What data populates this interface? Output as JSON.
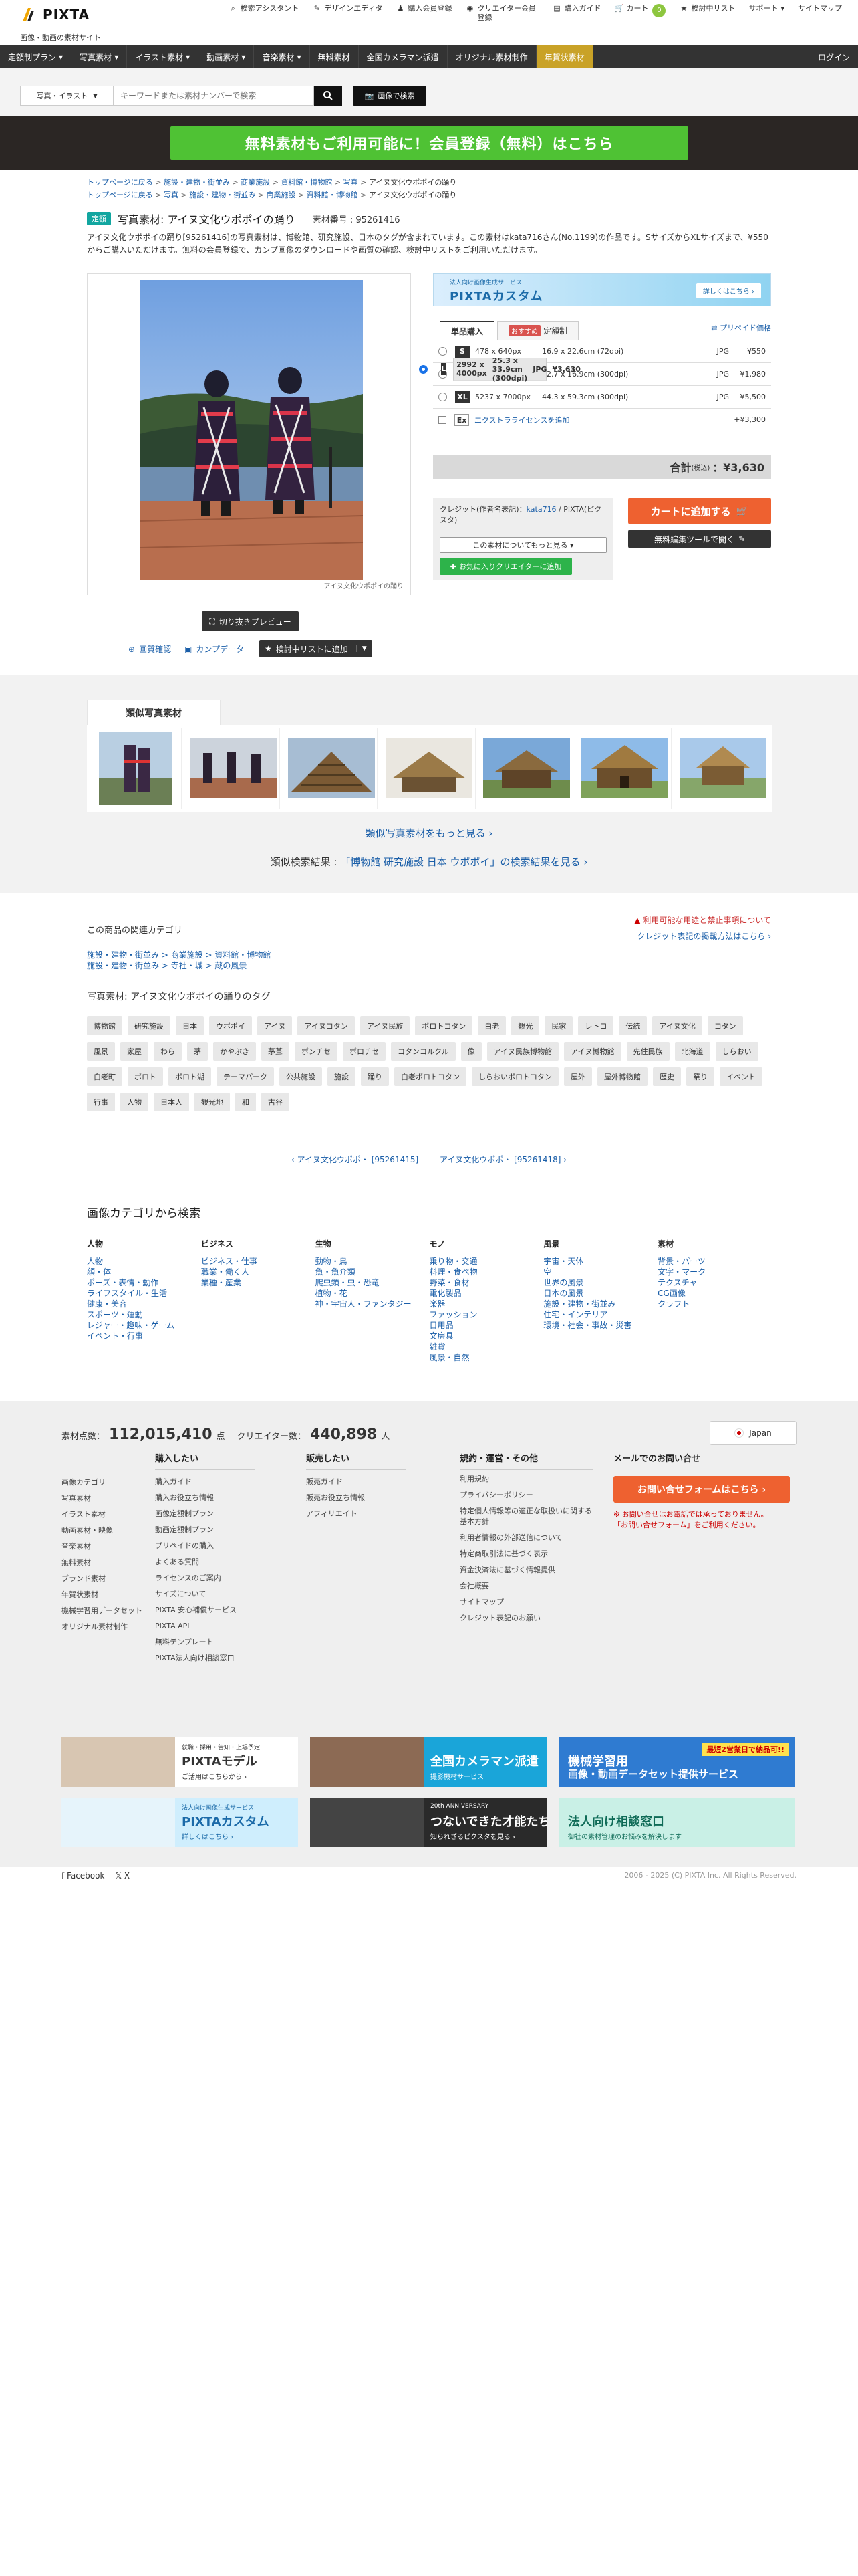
{
  "header": {
    "logo": "PIXTA",
    "subtitle": "画像・動画の素材サイト",
    "nav": [
      {
        "icon": "search-icon",
        "glyph": "⌕",
        "label": "検索アシスタント"
      },
      {
        "icon": "design-icon",
        "glyph": "✎",
        "label": "デザインエディタ"
      },
      {
        "icon": "register-icon",
        "glyph": "♟",
        "label": "購入会員登録"
      },
      {
        "icon": "camera-icon",
        "glyph": "◉",
        "label": "クリエイター会員登録"
      },
      {
        "icon": "guide-icon",
        "glyph": "▤",
        "label": "購入ガイド"
      },
      {
        "icon": "cart-icon",
        "glyph": "🛒",
        "label": "カート",
        "badge": "0"
      },
      {
        "icon": "star-icon",
        "glyph": "★",
        "label": "検討中リスト"
      },
      {
        "icon": "chevron-down-icon",
        "glyph": "",
        "label": "サポート"
      },
      {
        "icon": "sitemap-icon",
        "glyph": "",
        "label": "サイトマップ"
      }
    ]
  },
  "categories": [
    "定額制プラン",
    "写真素材",
    "イラスト素材",
    "動画素材",
    "音楽素材",
    "無料素材",
    "全国カメラマン派遣",
    "オリジナル素材制作",
    "年賀状素材"
  ],
  "login": "ログイン",
  "search": {
    "select_label": "写真・イラスト",
    "placeholder": "キーワードまたは素材ナンバーで検索",
    "image_search": "画像で検索"
  },
  "banner": {
    "text": "無料素材もご利用可能に！会員登録（無料）はこちら"
  },
  "breadcrumbs": [
    [
      "トップページに戻る",
      "施設・建物・街並み",
      "商業施設",
      "資料館・博物館",
      "写真",
      "アイヌ文化ウポポイの踊り"
    ],
    [
      "トップページに戻る",
      "写真",
      "施設・建物・街並み",
      "商業施設",
      "資料館・博物館",
      "アイヌ文化ウポポイの踊り"
    ]
  ],
  "product": {
    "badge": "定額",
    "title": "写真素材: アイヌ文化ウポポイの踊り",
    "number": "素材番号 : 95261416",
    "description": "アイヌ文化ウポポイの踊り[95261416]の写真素材は、博物館、研究施設、日本のタグが含まれています。この素材はkata716さん(No.1199)の作品です。SサイズからXLサイズまで、¥550からご購入いただけます。無料の会員登録で、カンプ画像のダウンロードや画質の確認、検討中リストをご利用いただけます。",
    "caption": "アイヌ文化ウポポイの踊り",
    "trim_preview": "切り抜きプレビュー",
    "actions": {
      "quality": "画質確認",
      "comp": "カンプデータ",
      "add_list": "検討中リストに追加"
    }
  },
  "purchase": {
    "custom_banner": {
      "small": "法人向け画像生成サービス",
      "big": "PIXTAカスタム",
      "btn": "詳しくはこちら ›"
    },
    "tab_single": "単品購入",
    "tab_sub_badge": "おすすめ",
    "tab_sub": "定額制",
    "prepaid": "プリペイド価格",
    "rows": [
      {
        "size": "S",
        "px": "478 x 640px",
        "dim": "16.9 x 22.6cm (72dpi)",
        "fmt": "JPG",
        "price": "¥550",
        "selected": false
      },
      {
        "size": "M",
        "px": "1496 x 2000px",
        "dim": "12.7 x 16.9cm (300dpi)",
        "fmt": "JPG",
        "price": "¥1,980",
        "selected": false
      },
      {
        "size": "L",
        "px": "2992 x 4000px",
        "dim": "25.3 x 33.9cm (300dpi)",
        "fmt": "JPG",
        "price": "¥3,630",
        "selected": true
      },
      {
        "size": "XL",
        "px": "5237 x 7000px",
        "dim": "44.3 x 59.3cm (300dpi)",
        "fmt": "JPG",
        "price": "¥5,500",
        "selected": false
      }
    ],
    "extra": {
      "size": "Ex",
      "label": "エクストラライセンスを追加",
      "price": "+¥3,300"
    },
    "total_label": "合計",
    "total_tax": "(税込)",
    "total": "：¥3,630",
    "credit_label": "クレジット(作者名表記)：",
    "credit_author": "kata716",
    "credit_rest": " / PIXTA(ピクスタ)",
    "more_btn": "この素材についてもっと見る ▾",
    "fav_btn": "お気に入りクリエイターに追加",
    "cart_btn": "カートに追加する",
    "edit_btn": "無料編集ツールで開く"
  },
  "similar": {
    "title": "類似写真素材",
    "more": "類似写真素材をもっと見る ›",
    "search_prefix": "類似検索結果 : ",
    "search_link": "「博物館 研究施設 日本 ウポポイ」の検索結果を見る ›"
  },
  "related": {
    "title": "この商品の関連カテゴリ",
    "links": [
      "施設・建物・街並み > 商業施設 > 資料館・博物館",
      "施設・建物・街並み > 寺社・城 > 蔵の風景"
    ],
    "right_links": [
      "利用可能な用途と禁止事項について",
      "クレジット表記の掲載方法はこちら ›"
    ]
  },
  "tags": {
    "title": "写真素材: アイヌ文化ウポポイの踊りのタグ",
    "items": [
      "博物館",
      "研究施設",
      "日本",
      "ウポポイ",
      "アイヌ",
      "アイヌコタン",
      "アイヌ民族",
      "ポロトコタン",
      "白老",
      "観光",
      "民家",
      "レトロ",
      "伝統",
      "アイヌ文化",
      "コタン",
      "風景",
      "家屋",
      "わら",
      "茅",
      "かやぶき",
      "茅葺",
      "ポンチセ",
      "ポロチセ",
      "コタンコルクル",
      "像",
      "アイヌ民族博物館",
      "アイヌ博物館",
      "先住民族",
      "北海道",
      "しらおい",
      "白老町",
      "ポロト",
      "ポロト湖",
      "テーマパーク",
      "公共施設",
      "施設",
      "踊り",
      "白老ポロトコタン",
      "しらおいポロトコタン",
      "屋外",
      "屋外博物館",
      "歴史",
      "祭り",
      "イベント",
      "行事",
      "人物",
      "日本人",
      "観光地",
      "和",
      "古谷"
    ]
  },
  "pager": {
    "prev": "‹ アイヌ文化ウポポ・ [95261415]",
    "next": "アイヌ文化ウポポ・ [95261418] ›"
  },
  "cat_search": {
    "title": "画像カテゴリから検索",
    "cols": [
      {
        "h": "人物",
        "items": [
          "人物",
          "顔・体",
          "ポーズ・表情・動作",
          "ライフスタイル・生活",
          "健康・美容",
          "スポーツ・運動",
          "レジャー・趣味・ゲーム",
          "イベント・行事"
        ]
      },
      {
        "h": "ビジネス",
        "items": [
          "ビジネス・仕事",
          "職業・働く人",
          "業種・産業"
        ]
      },
      {
        "h": "生物",
        "items": [
          "動物・鳥",
          "魚・魚介類",
          "爬虫類・虫・恐竜",
          "植物・花",
          "神・宇宙人・ファンタジー"
        ]
      },
      {
        "h": "モノ",
        "items": [
          "乗り物・交通",
          "料理・食べ物",
          "野菜・食材",
          "電化製品",
          "楽器",
          "ファッション",
          "日用品",
          "文房具",
          "雑貨",
          "風景・自然"
        ]
      },
      {
        "h": "風景",
        "items": [
          "宇宙・天体",
          "空",
          "世界の風景",
          "日本の風景",
          "施設・建物・街並み",
          "住宅・インテリア",
          "環境・社会・事故・災害"
        ]
      },
      {
        "h": "素材",
        "items": [
          "背景・パーツ",
          "文字・マーク",
          "テクスチャ",
          "CG画像",
          "クラフト"
        ]
      }
    ]
  },
  "footer": {
    "count_label": "素材点数：",
    "count": "112,015,410",
    "count_unit": "点",
    "creator_label": "クリエイター数：",
    "creator_count": "440,898",
    "creator_unit": "人",
    "lang": "Japan",
    "col1": [
      "画像カテゴリ",
      "写真素材",
      "イラスト素材",
      "動画素材・映像",
      "音楽素材",
      "無料素材",
      "ブランド素材",
      "年賀状素材",
      "機械学習用データセット",
      "オリジナル素材制作"
    ],
    "buy": {
      "h": "購入したい",
      "items": [
        "購入ガイド",
        "購入お役立ち情報",
        "画像定額制プラン",
        "動画定額制プラン",
        "プリペイドの購入",
        "よくある質問",
        "ライセンスのご案内",
        "サイズについて",
        "PIXTA 安心補償サービス",
        "PIXTA API",
        "無料テンプレート",
        "PIXTA法人向け相談窓口"
      ]
    },
    "sell": {
      "h": "販売したい",
      "items": [
        "販売ガイド",
        "販売お役立ち情報",
        "アフィリエイト"
      ]
    },
    "terms": {
      "h": "規約・運営・その他",
      "items": [
        "利用規約",
        "プライバシーポリシー",
        "特定個人情報等の適正な取扱いに関する基本方針",
        "利用者情報の外部送信について",
        "特定商取引法に基づく表示",
        "資金決済法に基づく情報提供",
        "会社概要",
        "サイトマップ",
        "クレジット表記のお願い"
      ]
    },
    "mail": {
      "h": "メールでのお問い合せ",
      "btn": "お問い合せフォームはこちら ›",
      "note1": "※ お問い合せはお電話では承っておりません。",
      "note2": "「お問い合せフォーム」をご利用ください。"
    },
    "ads": [
      {
        "name": "ad-pixta-model",
        "small": "就職・採用・告知・上場予定",
        "big": "PIXTAモデル",
        "sub": "ご活用はこちらから ›",
        "bg": "#ffffff",
        "fg": "#333333"
      },
      {
        "name": "ad-camera-dispatch",
        "small": "",
        "big": "全国カメラマン派遣",
        "sub": "撮影機材サービス",
        "bg": "#1aa5d9",
        "fg": "#ffffff"
      },
      {
        "name": "ad-ml-dataset",
        "small": "",
        "big": "機械学習用",
        "sub": "画像・動画データセット提供サービス",
        "badge": "最短2営業日で納品可!!",
        "bg": "#2f7bd1",
        "fg": "#ffffff"
      },
      {
        "name": "ad-pixta-custom",
        "small": "法人向け画像生成サービス",
        "big": "PIXTAカスタム",
        "sub": "詳しくはこちら ›",
        "bg": "#cfeefd",
        "fg": "#1b6aa8"
      },
      {
        "name": "ad-20th",
        "small": "20th ANNIVERSARY",
        "big": "つないできた才能たち",
        "sub": "知られざるピクスタを見る ›",
        "bg": "#2a2a2a",
        "fg": "#ffffff"
      },
      {
        "name": "ad-consult",
        "small": "",
        "big": "法人向け相談窓口",
        "sub": "御社の素材管理のお悩みを解決します",
        "bg": "#c9f0e6",
        "fg": "#0f6b57"
      }
    ],
    "social": [
      "f Facebook",
      "𝕏 X"
    ],
    "copyright": "2006 - 2025 (C) PIXTA Inc. All Rights Reserved."
  }
}
